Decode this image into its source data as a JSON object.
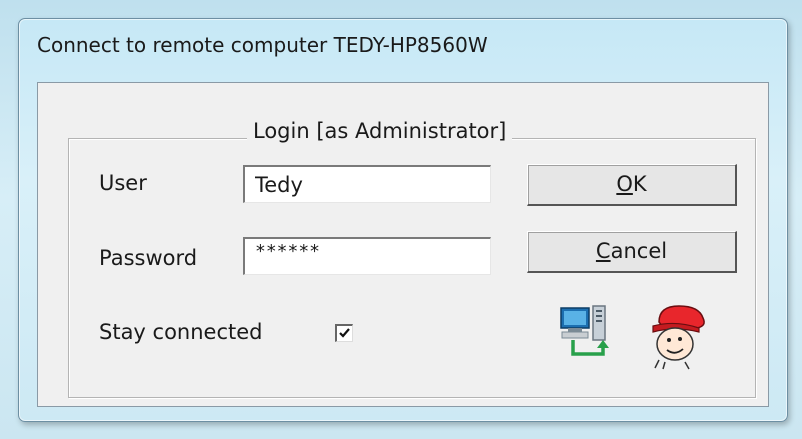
{
  "window": {
    "title": "Connect to remote computer TEDY-HP8560W"
  },
  "group": {
    "legend": "Login [as Administrator]"
  },
  "form": {
    "user_label": "User",
    "user_value": "Tedy",
    "password_label": "Password",
    "password_value": "******",
    "stay_connected_label": "Stay connected",
    "stay_connected_checked": true
  },
  "buttons": {
    "ok_label": "OK",
    "ok_mnemonic": "O",
    "ok_rest": "K",
    "cancel_label": "Cancel",
    "cancel_mnemonic": "C",
    "cancel_rest": "ancel"
  },
  "icons": [
    "network-computer-icon",
    "mascot-icon"
  ]
}
